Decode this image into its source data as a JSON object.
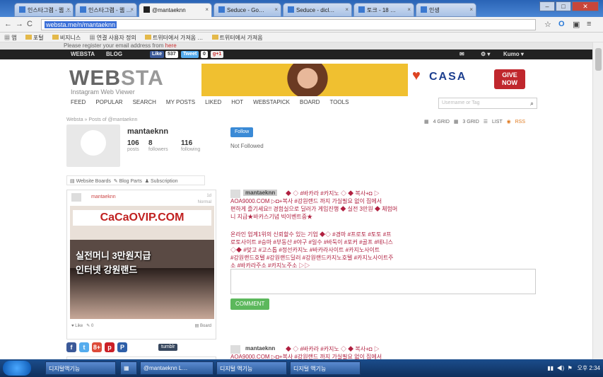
{
  "browser": {
    "tabs": [
      {
        "label": "인스타그램 - 웹 …",
        "active": false
      },
      {
        "label": "인스타그램 - 웹 …",
        "active": false
      },
      {
        "label": "@mantaeknn ",
        "active": true
      },
      {
        "label": "Seduce - Go…",
        "active": false
      },
      {
        "label": "Seduce - dicl…",
        "active": false
      },
      {
        "label": "토크 - 18 …",
        "active": false
      },
      {
        "label": "인생",
        "active": false
      }
    ],
    "url": "websta.me/n/mantaeknn",
    "bookmarks": [
      "앱",
      "포털",
      "비지니스",
      "연결 사용자 정의",
      "트위터에서 가져옴 …",
      "트위터에서 가져옴"
    ]
  },
  "site": {
    "register_text": "Please register your email address from",
    "register_link": "here",
    "topbar": {
      "brand": "WEBSTA",
      "blog": "BLOG",
      "like_label": "Like",
      "like_count": "537",
      "tweet_label": "Tweet",
      "g_label": "g+1",
      "g_count": "0",
      "right_user": "Kumo ▾"
    },
    "logo_main": "WEB",
    "logo_accent": "STA",
    "logo_sub": "Instagram Web Viewer",
    "banner": {
      "org": "CASA",
      "cta": "GIVE NOW"
    },
    "nav": [
      "FEED",
      "POPULAR",
      "SEARCH",
      "MY POSTS",
      "LIKED",
      "HOT",
      "WEBSTAPICK",
      "BOARD",
      "TOOLS"
    ],
    "search_placeholder": "Username or Tag"
  },
  "profile": {
    "breadcrumb": "Websta » Posts of @mantaeknn",
    "name": "mantaeknn",
    "posts": "106",
    "followers": "8",
    "following": "116",
    "posts_label": "posts",
    "followers_label": "followers",
    "following_label": "following",
    "follow_btn": "Follow",
    "status": "Not Followed",
    "view_options": [
      "4 GRID",
      "3 GRID",
      "LIST",
      "RSS"
    ],
    "sub_links": [
      "Website Boards",
      "Blog Parts",
      "Subscription"
    ]
  },
  "post": {
    "user": "mantaeknn",
    "time": "1d",
    "time_sub": "Normal",
    "image_text_1": "CaCaOVIP.COM",
    "image_text_2": "실전머니 3만원지급",
    "image_text_3": "인터넷 강원랜드",
    "likes": "Like",
    "comments": "0",
    "board": "Board",
    "share_label": "tumblr +",
    "social": [
      "f",
      "t",
      "8+",
      "p",
      "P"
    ]
  },
  "post2": {
    "user": "mantaeknn"
  },
  "comments": [
    {
      "name": "mantaeknn",
      "lines": [
        "◆ ◇ #바카라 #카지노 ◇ ◆ 복사+◘ ▷",
        "AOA9000.COM ▷◘+복사 #강원랜드 까지 가실필요 없이 집에서",
        "편하게 즐기세요!! 경험실으로 딜러가 게임진행 ◆ 실전 3만원 ◆ 체험머",
        "니 지급★바카스기념 빅이벤트중★"
      ]
    },
    {
      "name": "",
      "lines": [
        "온라인 업계1위의 신뢰할수 있는 기업 ◆◇ #경마 #프로토 #토토 #프",
        "로토사이트 #승마 #부동산 #야구 #일수 #바둑이 #포커 #골프 #테니스",
        "◇◆ #맞고 #고스톱 #정선카지노 #바카라사이트 #카지노사이트",
        "#강원랜드호텔 #강원랜드딜러 #강원랜드카지노호텔 #카지노사이트주",
        "소 #바카라주소 #카지노주소 ▷▷"
      ]
    }
  ],
  "comment_btn": "COMMENT",
  "post2_comment": "◆ ◇ #바카라 #카지노 ◇ ◆ 복사+◘ ▷",
  "post2_comment_2": "AOA9000.COM ▷◘+복사 #강원랜드 까지 가실필요 없이 집에서",
  "taskbar": {
    "tasks": [
      "디지털액기능",
      "",
      "@mantaeknn L…",
      "디지털 액기능",
      "디지털 액기능"
    ],
    "clock": "오후 2:34"
  }
}
